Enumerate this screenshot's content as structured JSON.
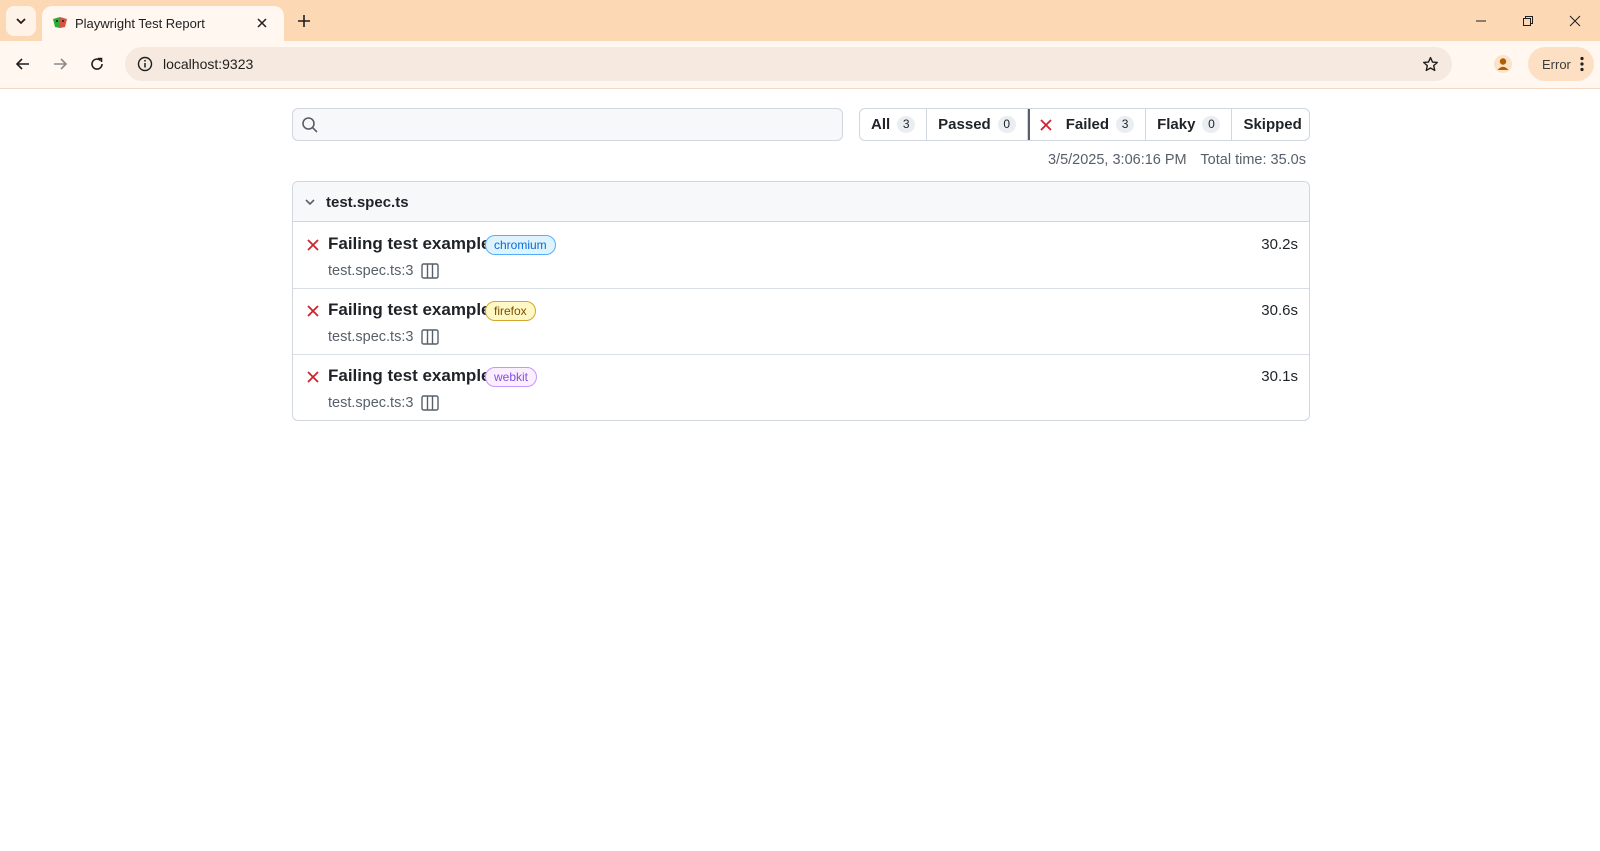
{
  "browser": {
    "tab": {
      "title": "Playwright Test Report"
    },
    "address_bar": {
      "url": "localhost:9323"
    },
    "profile_menu": {
      "label": "Error"
    }
  },
  "report": {
    "search": {
      "placeholder": "",
      "value": ""
    },
    "filters": [
      {
        "label": "All",
        "count": "3"
      },
      {
        "label": "Passed",
        "count": "0"
      },
      {
        "label": "Failed",
        "count": "3"
      },
      {
        "label": "Flaky",
        "count": "0"
      },
      {
        "label": "Skipped",
        "count": "0"
      }
    ],
    "meta": {
      "date": "3/5/2025, 3:06:16 PM",
      "total_time": "Total time: 35.0s"
    },
    "file": {
      "name": "test.spec.ts",
      "tests": [
        {
          "title": "Failing test example",
          "tag": "chromium",
          "location": "test.spec.ts:3",
          "duration": "30.2s",
          "status": "failed"
        },
        {
          "title": "Failing test example",
          "tag": "firefox",
          "location": "test.spec.ts:3",
          "duration": "30.6s",
          "status": "failed"
        },
        {
          "title": "Failing test example",
          "tag": "webkit",
          "location": "test.spec.ts:3",
          "duration": "30.1s",
          "status": "failed"
        }
      ]
    }
  },
  "colors": {
    "tabstrip": "#fdd8b5",
    "failed": "#cf222e",
    "chromium_tag": "#0969da",
    "firefox_tag": "#7d4e00",
    "webkit_tag": "#8250df"
  },
  "icons": {
    "tab_list": "chevron-down-icon",
    "favicon": "playwright-icon",
    "tab_close": "close-icon",
    "new_tab": "plus-icon",
    "back": "arrow-left-icon",
    "forward": "arrow-right-icon",
    "reload": "reload-icon",
    "site_info": "info-icon",
    "bookmark": "star-icon",
    "profile": "person-icon",
    "menu": "more-vertical-icon",
    "search": "search-icon",
    "failed": "x-icon",
    "collapse": "chevron-down-icon",
    "trace": "trace-columns-icon"
  }
}
